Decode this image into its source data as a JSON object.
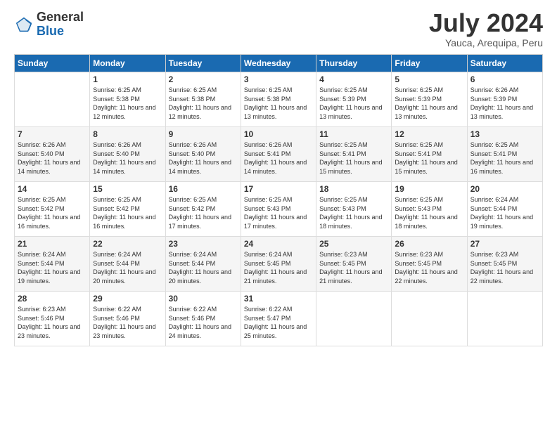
{
  "logo": {
    "general": "General",
    "blue": "Blue"
  },
  "title": "July 2024",
  "location": "Yauca, Arequipa, Peru",
  "days_of_week": [
    "Sunday",
    "Monday",
    "Tuesday",
    "Wednesday",
    "Thursday",
    "Friday",
    "Saturday"
  ],
  "weeks": [
    [
      {
        "day": "",
        "sunrise": "",
        "sunset": "",
        "daylight": ""
      },
      {
        "day": "1",
        "sunrise": "6:25 AM",
        "sunset": "5:38 PM",
        "daylight": "11 hours and 12 minutes."
      },
      {
        "day": "2",
        "sunrise": "6:25 AM",
        "sunset": "5:38 PM",
        "daylight": "11 hours and 12 minutes."
      },
      {
        "day": "3",
        "sunrise": "6:25 AM",
        "sunset": "5:38 PM",
        "daylight": "11 hours and 13 minutes."
      },
      {
        "day": "4",
        "sunrise": "6:25 AM",
        "sunset": "5:39 PM",
        "daylight": "11 hours and 13 minutes."
      },
      {
        "day": "5",
        "sunrise": "6:25 AM",
        "sunset": "5:39 PM",
        "daylight": "11 hours and 13 minutes."
      },
      {
        "day": "6",
        "sunrise": "6:26 AM",
        "sunset": "5:39 PM",
        "daylight": "11 hours and 13 minutes."
      }
    ],
    [
      {
        "day": "7",
        "sunrise": "6:26 AM",
        "sunset": "5:40 PM",
        "daylight": "11 hours and 14 minutes."
      },
      {
        "day": "8",
        "sunrise": "6:26 AM",
        "sunset": "5:40 PM",
        "daylight": "11 hours and 14 minutes."
      },
      {
        "day": "9",
        "sunrise": "6:26 AM",
        "sunset": "5:40 PM",
        "daylight": "11 hours and 14 minutes."
      },
      {
        "day": "10",
        "sunrise": "6:26 AM",
        "sunset": "5:41 PM",
        "daylight": "11 hours and 14 minutes."
      },
      {
        "day": "11",
        "sunrise": "6:25 AM",
        "sunset": "5:41 PM",
        "daylight": "11 hours and 15 minutes."
      },
      {
        "day": "12",
        "sunrise": "6:25 AM",
        "sunset": "5:41 PM",
        "daylight": "11 hours and 15 minutes."
      },
      {
        "day": "13",
        "sunrise": "6:25 AM",
        "sunset": "5:41 PM",
        "daylight": "11 hours and 16 minutes."
      }
    ],
    [
      {
        "day": "14",
        "sunrise": "6:25 AM",
        "sunset": "5:42 PM",
        "daylight": "11 hours and 16 minutes."
      },
      {
        "day": "15",
        "sunrise": "6:25 AM",
        "sunset": "5:42 PM",
        "daylight": "11 hours and 16 minutes."
      },
      {
        "day": "16",
        "sunrise": "6:25 AM",
        "sunset": "5:42 PM",
        "daylight": "11 hours and 17 minutes."
      },
      {
        "day": "17",
        "sunrise": "6:25 AM",
        "sunset": "5:43 PM",
        "daylight": "11 hours and 17 minutes."
      },
      {
        "day": "18",
        "sunrise": "6:25 AM",
        "sunset": "5:43 PM",
        "daylight": "11 hours and 18 minutes."
      },
      {
        "day": "19",
        "sunrise": "6:25 AM",
        "sunset": "5:43 PM",
        "daylight": "11 hours and 18 minutes."
      },
      {
        "day": "20",
        "sunrise": "6:24 AM",
        "sunset": "5:44 PM",
        "daylight": "11 hours and 19 minutes."
      }
    ],
    [
      {
        "day": "21",
        "sunrise": "6:24 AM",
        "sunset": "5:44 PM",
        "daylight": "11 hours and 19 minutes."
      },
      {
        "day": "22",
        "sunrise": "6:24 AM",
        "sunset": "5:44 PM",
        "daylight": "11 hours and 20 minutes."
      },
      {
        "day": "23",
        "sunrise": "6:24 AM",
        "sunset": "5:44 PM",
        "daylight": "11 hours and 20 minutes."
      },
      {
        "day": "24",
        "sunrise": "6:24 AM",
        "sunset": "5:45 PM",
        "daylight": "11 hours and 21 minutes."
      },
      {
        "day": "25",
        "sunrise": "6:23 AM",
        "sunset": "5:45 PM",
        "daylight": "11 hours and 21 minutes."
      },
      {
        "day": "26",
        "sunrise": "6:23 AM",
        "sunset": "5:45 PM",
        "daylight": "11 hours and 22 minutes."
      },
      {
        "day": "27",
        "sunrise": "6:23 AM",
        "sunset": "5:45 PM",
        "daylight": "11 hours and 22 minutes."
      }
    ],
    [
      {
        "day": "28",
        "sunrise": "6:23 AM",
        "sunset": "5:46 PM",
        "daylight": "11 hours and 23 minutes."
      },
      {
        "day": "29",
        "sunrise": "6:22 AM",
        "sunset": "5:46 PM",
        "daylight": "11 hours and 23 minutes."
      },
      {
        "day": "30",
        "sunrise": "6:22 AM",
        "sunset": "5:46 PM",
        "daylight": "11 hours and 24 minutes."
      },
      {
        "day": "31",
        "sunrise": "6:22 AM",
        "sunset": "5:47 PM",
        "daylight": "11 hours and 25 minutes."
      },
      {
        "day": "",
        "sunrise": "",
        "sunset": "",
        "daylight": ""
      },
      {
        "day": "",
        "sunrise": "",
        "sunset": "",
        "daylight": ""
      },
      {
        "day": "",
        "sunrise": "",
        "sunset": "",
        "daylight": ""
      }
    ]
  ]
}
